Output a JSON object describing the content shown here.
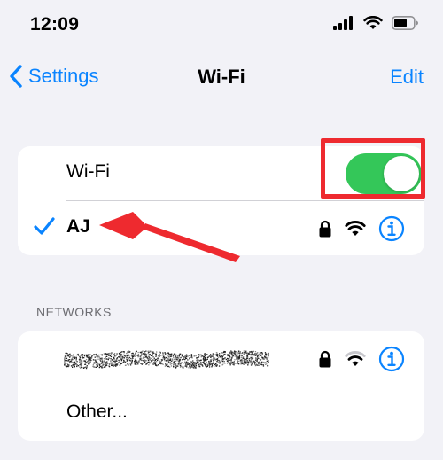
{
  "status_bar": {
    "time": "12:09",
    "icons": [
      "cellular-signal-icon",
      "wifi-status-icon",
      "battery-icon"
    ]
  },
  "nav": {
    "back_label": "Settings",
    "title": "Wi-Fi",
    "edit_label": "Edit"
  },
  "wifi_toggle": {
    "label": "Wi-Fi",
    "state": "on"
  },
  "connected_network": {
    "name": "AJ",
    "secured": true,
    "signal": "full"
  },
  "networks_section": {
    "header": "NETWORKS",
    "items": [
      {
        "name": "",
        "secured": true,
        "signal": "medium"
      }
    ],
    "other_label": "Other..."
  },
  "colors": {
    "accent": "#0a84ff",
    "toggle_on": "#34c759",
    "annotation": "#ee2a2f",
    "background": "#f2f2f7"
  }
}
